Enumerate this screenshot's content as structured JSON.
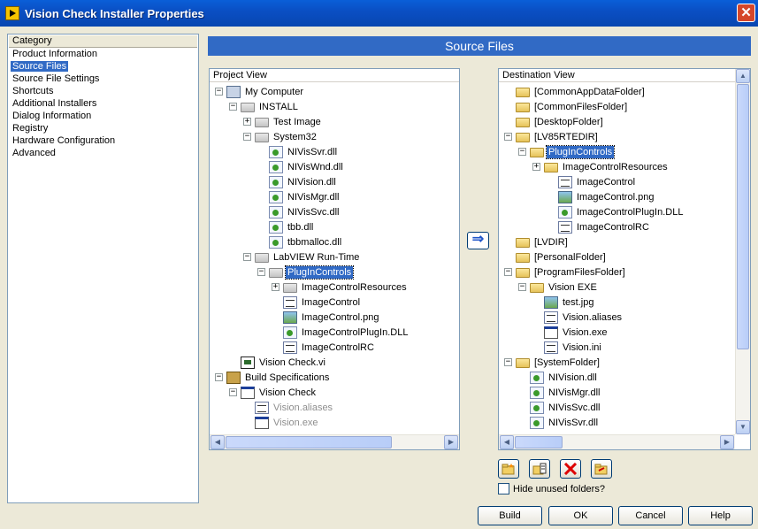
{
  "window": {
    "title": "Vision Check Installer Properties"
  },
  "category": {
    "header": "Category",
    "items": [
      "Product Information",
      "Source Files",
      "Source File Settings",
      "Shortcuts",
      "Additional Installers",
      "Dialog Information",
      "Registry",
      "Hardware Configuration",
      "Advanced"
    ],
    "selected": "Source Files"
  },
  "page": {
    "title": "Source Files"
  },
  "project": {
    "header": "Project View",
    "rows": [
      {
        "label": "My Computer",
        "icon": "computer-icon",
        "level": 0,
        "exp": "minus"
      },
      {
        "label": "INSTALL",
        "icon": "folder-gray-icon",
        "level": 1,
        "exp": "minus"
      },
      {
        "label": "Test Image",
        "icon": "folder-gray-icon",
        "level": 2,
        "exp": "plus"
      },
      {
        "label": "System32",
        "icon": "folder-gray-icon",
        "level": 2,
        "exp": "minus"
      },
      {
        "label": "NIVisSvr.dll",
        "icon": "dll-icon",
        "level": 3
      },
      {
        "label": "NIVisWnd.dll",
        "icon": "dll-icon",
        "level": 3
      },
      {
        "label": "NIVision.dll",
        "icon": "dll-icon",
        "level": 3
      },
      {
        "label": "NIVisMgr.dll",
        "icon": "dll-icon",
        "level": 3
      },
      {
        "label": "NIVisSvc.dll",
        "icon": "dll-icon",
        "level": 3
      },
      {
        "label": "tbb.dll",
        "icon": "dll-icon",
        "level": 3
      },
      {
        "label": "tbbmalloc.dll",
        "icon": "dll-icon",
        "level": 3
      },
      {
        "label": "LabVIEW Run-Time",
        "icon": "folder-gray-icon",
        "level": 2,
        "exp": "minus"
      },
      {
        "label": "PlugInControls",
        "icon": "folder-gray-icon",
        "level": 3,
        "exp": "minus",
        "selected": true
      },
      {
        "label": "ImageControlResources",
        "icon": "folder-gray-icon",
        "level": 4,
        "exp": "plus"
      },
      {
        "label": "ImageControl",
        "icon": "ctl-icon",
        "level": 4
      },
      {
        "label": "ImageControl.png",
        "icon": "png-icon",
        "level": 4
      },
      {
        "label": "ImageControlPlugIn.DLL",
        "icon": "dll-icon",
        "level": 4
      },
      {
        "label": "ImageControlRC",
        "icon": "ctl-icon",
        "level": 4
      },
      {
        "label": "Vision Check.vi",
        "icon": "vi-icon",
        "level": 1
      },
      {
        "label": "Build Specifications",
        "icon": "build-icon",
        "level": 0,
        "exp": "minus"
      },
      {
        "label": "Vision Check",
        "icon": "exe-icon",
        "level": 1,
        "exp": "minus"
      },
      {
        "label": "Vision.aliases",
        "icon": "ctl-icon",
        "level": 2,
        "dim": true
      },
      {
        "label": "Vision.exe",
        "icon": "exe-icon",
        "level": 2,
        "dim": true
      }
    ]
  },
  "destination": {
    "header": "Destination View",
    "rows": [
      {
        "label": "[CommonAppDataFolder]",
        "icon": "folder-icon",
        "level": 0
      },
      {
        "label": "[CommonFilesFolder]",
        "icon": "folder-icon",
        "level": 0
      },
      {
        "label": "[DesktopFolder]",
        "icon": "folder-icon",
        "level": 0
      },
      {
        "label": "[LV85RTEDIR]",
        "icon": "folder-icon",
        "level": 0,
        "exp": "minus"
      },
      {
        "label": "PlugInControls",
        "icon": "folder-icon",
        "level": 1,
        "exp": "minus",
        "selected": true
      },
      {
        "label": "ImageControlResources",
        "icon": "folder-icon",
        "level": 2,
        "exp": "plus"
      },
      {
        "label": "ImageControl",
        "icon": "ctl-icon",
        "level": 3
      },
      {
        "label": "ImageControl.png",
        "icon": "png-icon",
        "level": 3
      },
      {
        "label": "ImageControlPlugIn.DLL",
        "icon": "dll-icon",
        "level": 3
      },
      {
        "label": "ImageControlRC",
        "icon": "ctl-icon",
        "level": 3
      },
      {
        "label": "[LVDIR]",
        "icon": "folder-icon",
        "level": 0
      },
      {
        "label": "[PersonalFolder]",
        "icon": "folder-icon",
        "level": 0
      },
      {
        "label": "[ProgramFilesFolder]",
        "icon": "folder-icon",
        "level": 0,
        "exp": "minus"
      },
      {
        "label": "Vision EXE",
        "icon": "folder-icon",
        "level": 1,
        "exp": "minus"
      },
      {
        "label": "test.jpg",
        "icon": "png-icon",
        "level": 2
      },
      {
        "label": "Vision.aliases",
        "icon": "ctl-icon",
        "level": 2
      },
      {
        "label": "Vision.exe",
        "icon": "exe-icon",
        "level": 2
      },
      {
        "label": "Vision.ini",
        "icon": "ini-icon",
        "level": 2
      },
      {
        "label": "[SystemFolder]",
        "icon": "folder-icon",
        "level": 0,
        "exp": "minus"
      },
      {
        "label": "NIVision.dll",
        "icon": "dll-icon",
        "level": 1
      },
      {
        "label": "NIVisMgr.dll",
        "icon": "dll-icon",
        "level": 1
      },
      {
        "label": "NIVisSvc.dll",
        "icon": "dll-icon",
        "level": 1
      },
      {
        "label": "NIVisSvr.dll",
        "icon": "dll-icon",
        "level": 1
      }
    ]
  },
  "move_button": {
    "glyph": "⇒"
  },
  "toolbar": [
    {
      "name": "add-folder-button",
      "icon": "new-folder-icon"
    },
    {
      "name": "folder-properties-button",
      "icon": "folder-properties-icon"
    },
    {
      "name": "delete-button",
      "icon": "delete-icon"
    },
    {
      "name": "rename-folder-button",
      "icon": "rename-folder-icon"
    }
  ],
  "hide_unused": {
    "label": "Hide unused folders?",
    "checked": false
  },
  "buttons": {
    "build": "Build",
    "ok": "OK",
    "cancel": "Cancel",
    "help": "Help"
  },
  "colors": {
    "selection": "#316ac5",
    "header_bar": "#316ac5",
    "title_bar": "#0a4fc4"
  }
}
